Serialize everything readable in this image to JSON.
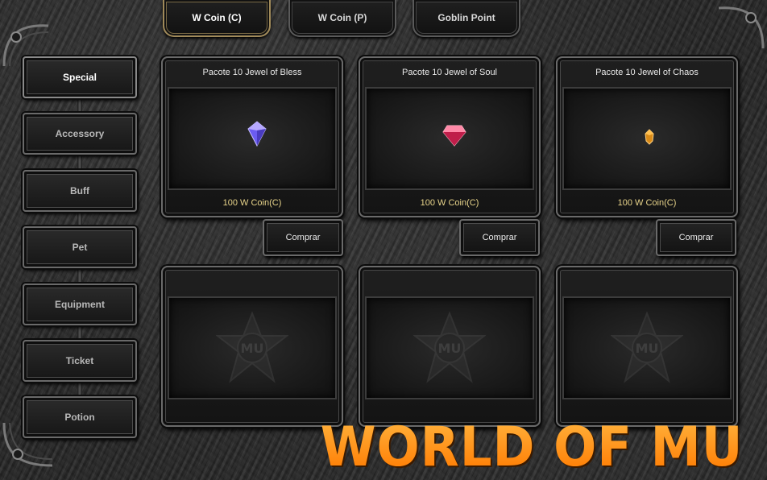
{
  "tabs": [
    {
      "label": "W Coin (C)",
      "active": true
    },
    {
      "label": "W Coin (P)",
      "active": false
    },
    {
      "label": "Goblin Point",
      "active": false
    }
  ],
  "sidebar": {
    "items": [
      {
        "label": "Special",
        "active": true
      },
      {
        "label": "Accessory",
        "active": false
      },
      {
        "label": "Buff",
        "active": false
      },
      {
        "label": "Pet",
        "active": false
      },
      {
        "label": "Equipment",
        "active": false
      },
      {
        "label": "Ticket",
        "active": false
      },
      {
        "label": "Potion",
        "active": false
      }
    ]
  },
  "products": [
    {
      "name": "Pacote 10 Jewel of Bless",
      "price": "100 W Coin(C)",
      "buy_label": "Comprar",
      "icon": "jewel-of-bless-icon",
      "color": "#7a6cff"
    },
    {
      "name": "Pacote 10 Jewel of Soul",
      "price": "100 W Coin(C)",
      "buy_label": "Comprar",
      "icon": "jewel-of-soul-icon",
      "color": "#ff4a7a"
    },
    {
      "name": "Pacote 10 Jewel of Chaos",
      "price": "100 W Coin(C)",
      "buy_label": "Comprar",
      "icon": "jewel-of-chaos-icon",
      "color": "#e09a20"
    }
  ],
  "empty_slots": [
    {
      "emblem_text": "MU"
    },
    {
      "emblem_text": "MU"
    },
    {
      "emblem_text": "MU"
    }
  ],
  "watermark": "WORLD OF MU",
  "colors": {
    "price": "#e8d48a",
    "watermark": "#ff8c00",
    "frame": "#6a6a6a"
  }
}
